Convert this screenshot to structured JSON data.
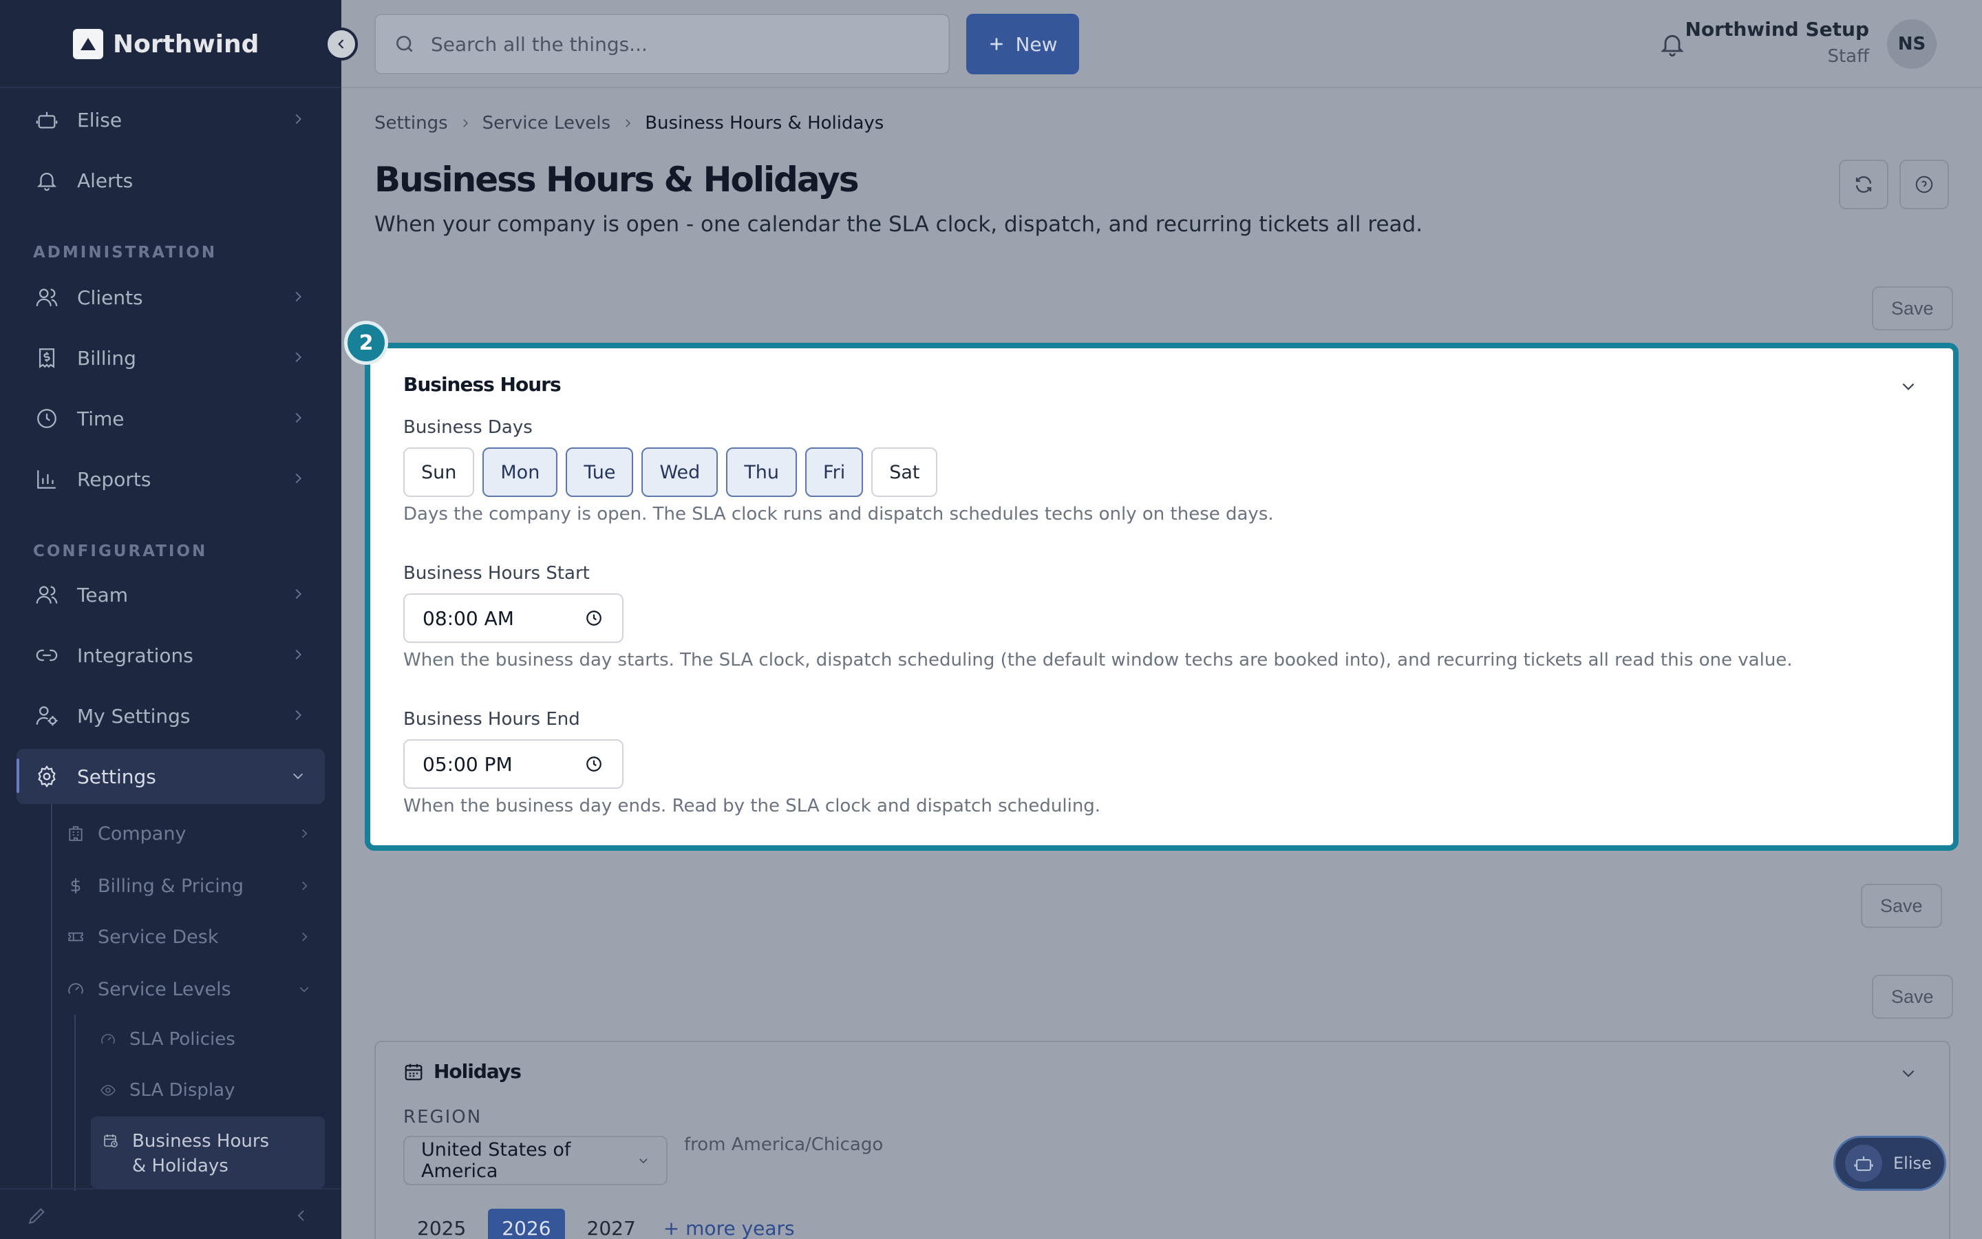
{
  "app": {
    "brand": "Northwind"
  },
  "search": {
    "placeholder": "Search all the things..."
  },
  "toolbar": {
    "new_label": "New"
  },
  "user": {
    "name": "Northwind Setup",
    "role": "Staff",
    "initials": "NS"
  },
  "sidebar": {
    "items_top": [
      {
        "label": "Elise",
        "icon": "robot-icon"
      },
      {
        "label": "Alerts",
        "icon": "bell-icon"
      }
    ],
    "administration_label": "ADMINISTRATION",
    "administration": [
      {
        "label": "Clients",
        "icon": "users-icon"
      },
      {
        "label": "Billing",
        "icon": "receipt-icon"
      },
      {
        "label": "Time",
        "icon": "clock-icon"
      },
      {
        "label": "Reports",
        "icon": "bar-chart-icon"
      }
    ],
    "configuration_label": "CONFIGURATION",
    "configuration": [
      {
        "label": "Team",
        "icon": "users-icon"
      },
      {
        "label": "Integrations",
        "icon": "link-icon"
      },
      {
        "label": "My Settings",
        "icon": "user-gear-icon"
      },
      {
        "label": "Settings",
        "icon": "gear-icon"
      }
    ],
    "settings_children": [
      {
        "label": "Company",
        "icon": "building-icon"
      },
      {
        "label": "Billing & Pricing",
        "icon": "dollar-icon"
      },
      {
        "label": "Service Desk",
        "icon": "ticket-icon"
      },
      {
        "label": "Service Levels",
        "icon": "gauge-icon"
      }
    ],
    "service_levels_children": [
      {
        "label": "SLA Policies",
        "icon": "gauge-icon"
      },
      {
        "label": "SLA Display",
        "icon": "eye-icon"
      },
      {
        "label": "Business Hours & Holidays",
        "icon": "calendar-clock-icon"
      }
    ]
  },
  "breadcrumb": [
    "Settings",
    "Service Levels",
    "Business Hours & Holidays"
  ],
  "page": {
    "title": "Business Hours & Holidays",
    "subtitle": "When your company is open - one calendar the SLA clock, dispatch, and recurring tickets all read."
  },
  "save_label": "Save",
  "business_hours": {
    "step": "2",
    "title": "Business Hours",
    "days_label": "Business Days",
    "days": [
      {
        "label": "Sun",
        "selected": false
      },
      {
        "label": "Mon",
        "selected": true
      },
      {
        "label": "Tue",
        "selected": true
      },
      {
        "label": "Wed",
        "selected": true
      },
      {
        "label": "Thu",
        "selected": true
      },
      {
        "label": "Fri",
        "selected": true
      },
      {
        "label": "Sat",
        "selected": false
      }
    ],
    "days_help": "Days the company is open. The SLA clock runs and dispatch schedules techs only on these days.",
    "start_label": "Business Hours Start",
    "start_value": "08:00 AM",
    "start_help": "When the business day starts. The SLA clock, dispatch scheduling (the default window techs are booked into), and recurring tickets all read this one value.",
    "end_label": "Business Hours End",
    "end_value": "05:00 PM",
    "end_help": "When the business day ends. Read by the SLA clock and dispatch scheduling."
  },
  "holidays": {
    "title": "Holidays",
    "region_label": "REGION",
    "region_value": "United States of America",
    "timezone_note": "from America/Chicago",
    "years": [
      {
        "label": "2025",
        "selected": false
      },
      {
        "label": "2026",
        "selected": true
      },
      {
        "label": "2027",
        "selected": false
      }
    ],
    "more_years": "+ more years"
  },
  "assistant_fab": {
    "label": "Elise"
  },
  "colors": {
    "sidebar": "#1e2740",
    "accent": "#36569a",
    "highlight": "#17819a"
  }
}
